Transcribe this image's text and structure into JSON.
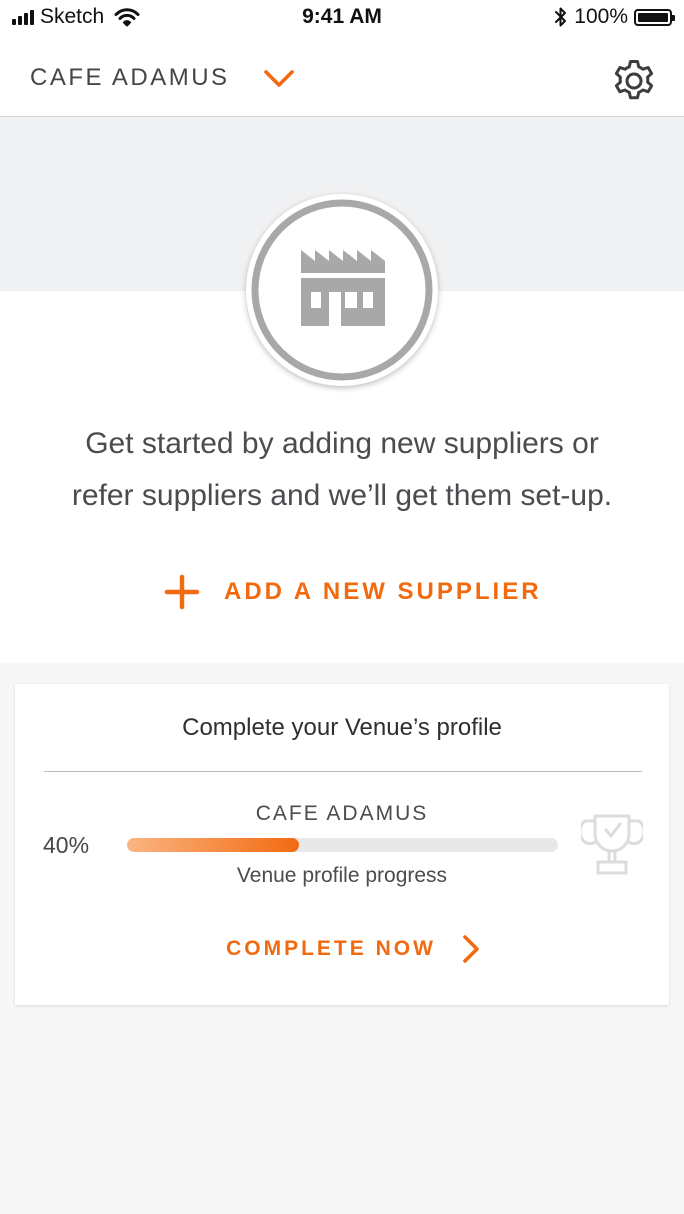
{
  "status_bar": {
    "carrier": "Sketch",
    "time": "9:41 AM",
    "battery": "100%",
    "icons": [
      "signal-icon",
      "wifi-icon",
      "bluetooth-icon",
      "battery-icon"
    ]
  },
  "header": {
    "venue_name": "CAFE ADAMUS",
    "icons": [
      "chevron-down-icon",
      "gear-icon"
    ]
  },
  "hero": {
    "icon": "factory-icon",
    "message_line1": "Get started by adding new suppliers or",
    "message_line2": "refer suppliers and we’ll get them set-up.",
    "add_supplier_label": "ADD A NEW SUPPLIER",
    "add_icon": "plus-icon"
  },
  "profile_card": {
    "title": "Complete your Venue’s profile",
    "venue_name": "CAFE ADAMUS",
    "progress_text": "40%",
    "progress_value": 0.4,
    "progress_caption": "Venue profile progress",
    "trophy_icon": "trophy-icon",
    "action_label": "COMPLETE NOW",
    "action_icon": "chevron-right-icon"
  },
  "colors": {
    "accent": "#f26a10",
    "progress_start": "#fbb582",
    "hero_background": "#f0f1f2",
    "page_background": "#f7f7f7",
    "icon_grey": "#a8a8a8"
  }
}
